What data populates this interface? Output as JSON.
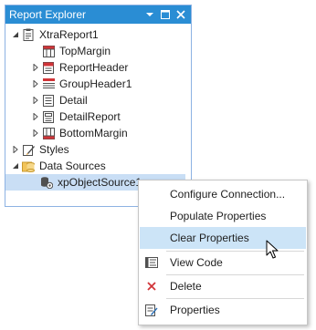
{
  "panel": {
    "title": "Report Explorer",
    "pin_icon": "pin-dropdown-icon",
    "maximize_icon": "maximize-icon",
    "close_icon": "close-icon"
  },
  "tree": {
    "root": "XtraReport1",
    "bands": [
      "TopMargin",
      "ReportHeader",
      "GroupHeader1",
      "Detail",
      "DetailReport",
      "BottomMargin"
    ],
    "styles": "Styles",
    "data_sources": "Data Sources",
    "data_source_item": "xpObjectSource1"
  },
  "context_menu": {
    "items": [
      {
        "label": "Configure Connection...",
        "icon": ""
      },
      {
        "label": "Populate Properties",
        "icon": ""
      },
      {
        "label": "Clear Properties",
        "icon": ""
      },
      {
        "label": "View Code",
        "icon": "view-code-icon"
      },
      {
        "label": "Delete",
        "icon": "delete-icon"
      },
      {
        "label": "Properties",
        "icon": "properties-icon"
      }
    ],
    "hovered": "Clear Properties"
  },
  "colors": {
    "titlebar": "#2a8dd4",
    "selection": "#c9def5",
    "menu_hover": "#cce4f7",
    "delete_red": "#d13438"
  }
}
